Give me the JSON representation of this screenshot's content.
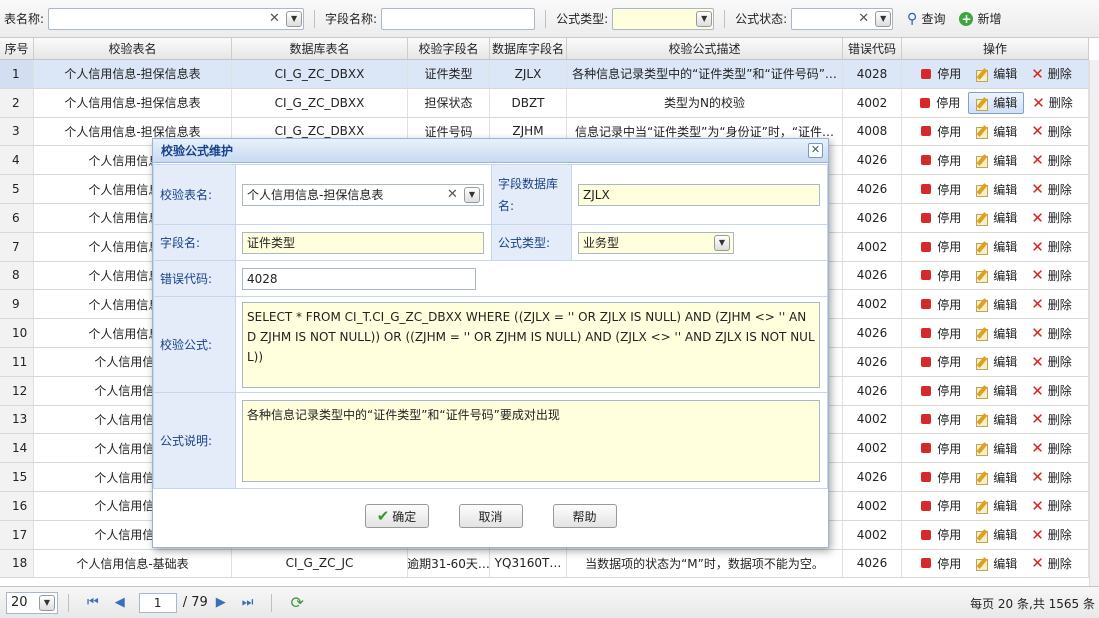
{
  "toolbar": {
    "table_name_label": "表名称:",
    "table_name_value": "",
    "field_name_label": "字段名称:",
    "field_name_value": "",
    "formula_type_label": "公式类型:",
    "formula_type_value": "",
    "formula_status_label": "公式状态:",
    "formula_status_value": "",
    "query_label": "查询",
    "add_label": "新增"
  },
  "grid": {
    "headers": [
      "序号",
      "校验表名",
      "数据库表名",
      "校验字段名",
      "数据库字段名",
      "校验公式描述",
      "错误代码",
      "操作"
    ],
    "op_labels": {
      "stop": "停用",
      "edit": "编辑",
      "delete": "删除"
    },
    "rows": [
      {
        "no": "1",
        "table": "个人信用信息-担保信息表",
        "db_table": "CI_G_ZC_DBXX",
        "field": "证件类型",
        "db_field": "ZJLX",
        "desc": "各种信息记录类型中的“证件类型”和“证件号码”…",
        "code": "4028",
        "selected": true
      },
      {
        "no": "2",
        "table": "个人信用信息-担保信息表",
        "db_table": "CI_G_ZC_DBXX",
        "field": "担保状态",
        "db_field": "DBZT",
        "desc": "类型为N的校验",
        "code": "4002"
      },
      {
        "no": "3",
        "table": "个人信用信息-担保信息表",
        "db_table": "CI_G_ZC_DBXX",
        "field": "证件号码",
        "db_field": "ZJHM",
        "desc": "信息记录中当“证件类型”为“身份证”时，“证件…",
        "code": "4008"
      },
      {
        "no": "4",
        "table": "个人信用信息-担",
        "db_table": "",
        "field": "",
        "db_field": "",
        "desc": "",
        "code": "4026"
      },
      {
        "no": "5",
        "table": "个人信用信息-担",
        "db_table": "",
        "field": "",
        "db_field": "",
        "desc": "",
        "code": "4026"
      },
      {
        "no": "6",
        "table": "个人信用信息-担",
        "db_table": "",
        "field": "",
        "db_field": "",
        "desc": "",
        "code": "4026"
      },
      {
        "no": "7",
        "table": "个人信用信息-担",
        "db_table": "",
        "field": "",
        "db_field": "",
        "desc": "",
        "code": "4002"
      },
      {
        "no": "8",
        "table": "个人信用信息-担",
        "db_table": "",
        "field": "",
        "db_field": "",
        "desc": "",
        "code": "4026"
      },
      {
        "no": "9",
        "table": "个人信用信息-担",
        "db_table": "",
        "field": "",
        "db_field": "",
        "desc": "",
        "code": "4002"
      },
      {
        "no": "10",
        "table": "个人信用信息-担",
        "db_table": "",
        "field": "",
        "db_field": "",
        "desc": "",
        "code": "4026"
      },
      {
        "no": "11",
        "table": "个人信用信息-",
        "db_table": "",
        "field": "",
        "db_field": "",
        "desc": "",
        "code": "4026"
      },
      {
        "no": "12",
        "table": "个人信用信息-",
        "db_table": "",
        "field": "",
        "db_field": "",
        "desc": "",
        "code": "4026"
      },
      {
        "no": "13",
        "table": "个人信用信息-",
        "db_table": "",
        "field": "",
        "db_field": "",
        "desc": "",
        "code": "4002"
      },
      {
        "no": "14",
        "table": "个人信用信息-",
        "db_table": "",
        "field": "",
        "db_field": "",
        "desc": "",
        "code": "4002"
      },
      {
        "no": "15",
        "table": "个人信用信息-",
        "db_table": "",
        "field": "",
        "db_field": "",
        "desc": "",
        "code": "4026"
      },
      {
        "no": "16",
        "table": "个人信用信息-",
        "db_table": "",
        "field": "",
        "db_field": "",
        "desc": "",
        "code": "4002"
      },
      {
        "no": "17",
        "table": "个人信用信息-",
        "db_table": "",
        "field": "",
        "db_field": "",
        "desc": "",
        "code": "4002"
      },
      {
        "no": "18",
        "table": "个人信用信息-基础表",
        "db_table": "CI_G_ZC_JC",
        "field": "逾期31-60天…",
        "db_field": "YQ3160T…",
        "desc": "当数据项的状态为“M”时，数据项不能为空。",
        "code": "4026"
      }
    ]
  },
  "pager": {
    "page_size": "20",
    "current_page": "1",
    "total_pages": "/ 79",
    "info": "每页 20 条,共 1565 条"
  },
  "dialog": {
    "title": "校验公式维护",
    "table_label": "校验表名:",
    "table_value": "个人信用信息-担保信息表",
    "db_field_label": "字段数据库名:",
    "db_field_value": "ZJLX",
    "field_label": "字段名:",
    "field_value": "证件类型",
    "formula_type_label": "公式类型:",
    "formula_type_value": "业务型",
    "error_code_label": "错误代码:",
    "error_code_value": "4028",
    "formula_label": "校验公式:",
    "formula_value": "SELECT * FROM CI_T.CI_G_ZC_DBXX WHERE ((ZJLX = '' OR ZJLX IS NULL) AND (ZJHM <> '' AND ZJHM IS NOT NULL)) OR ((ZJHM = '' OR ZJHM IS NULL) AND (ZJLX <> '' AND ZJLX IS NOT NULL))",
    "desc_label": "公式说明:",
    "desc_value": "各种信息记录类型中的“证件类型”和“证件号码”要成对出现",
    "ok_label": "确定",
    "cancel_label": "取消",
    "help_label": "帮助"
  }
}
